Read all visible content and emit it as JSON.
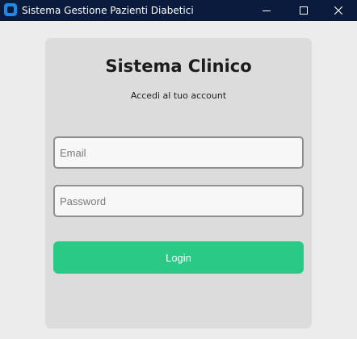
{
  "window": {
    "title": "Sistema Gestione Pazienti Diabetici",
    "icon": "app-icon",
    "controls": {
      "minimize_icon": "minimize-icon",
      "maximize_icon": "maximize-icon",
      "close_icon": "close-icon"
    }
  },
  "login": {
    "title": "Sistema Clinico",
    "subtitle": "Accedi al tuo account",
    "email_placeholder": "Email",
    "email_value": "",
    "password_placeholder": "Password",
    "password_value": "",
    "button_label": "Login"
  },
  "colors": {
    "titlebar": "#0b1b3d",
    "background": "#ececec",
    "card": "#dcdcdc",
    "accent": "#2bc986",
    "field_border": "#8f8f8f"
  }
}
